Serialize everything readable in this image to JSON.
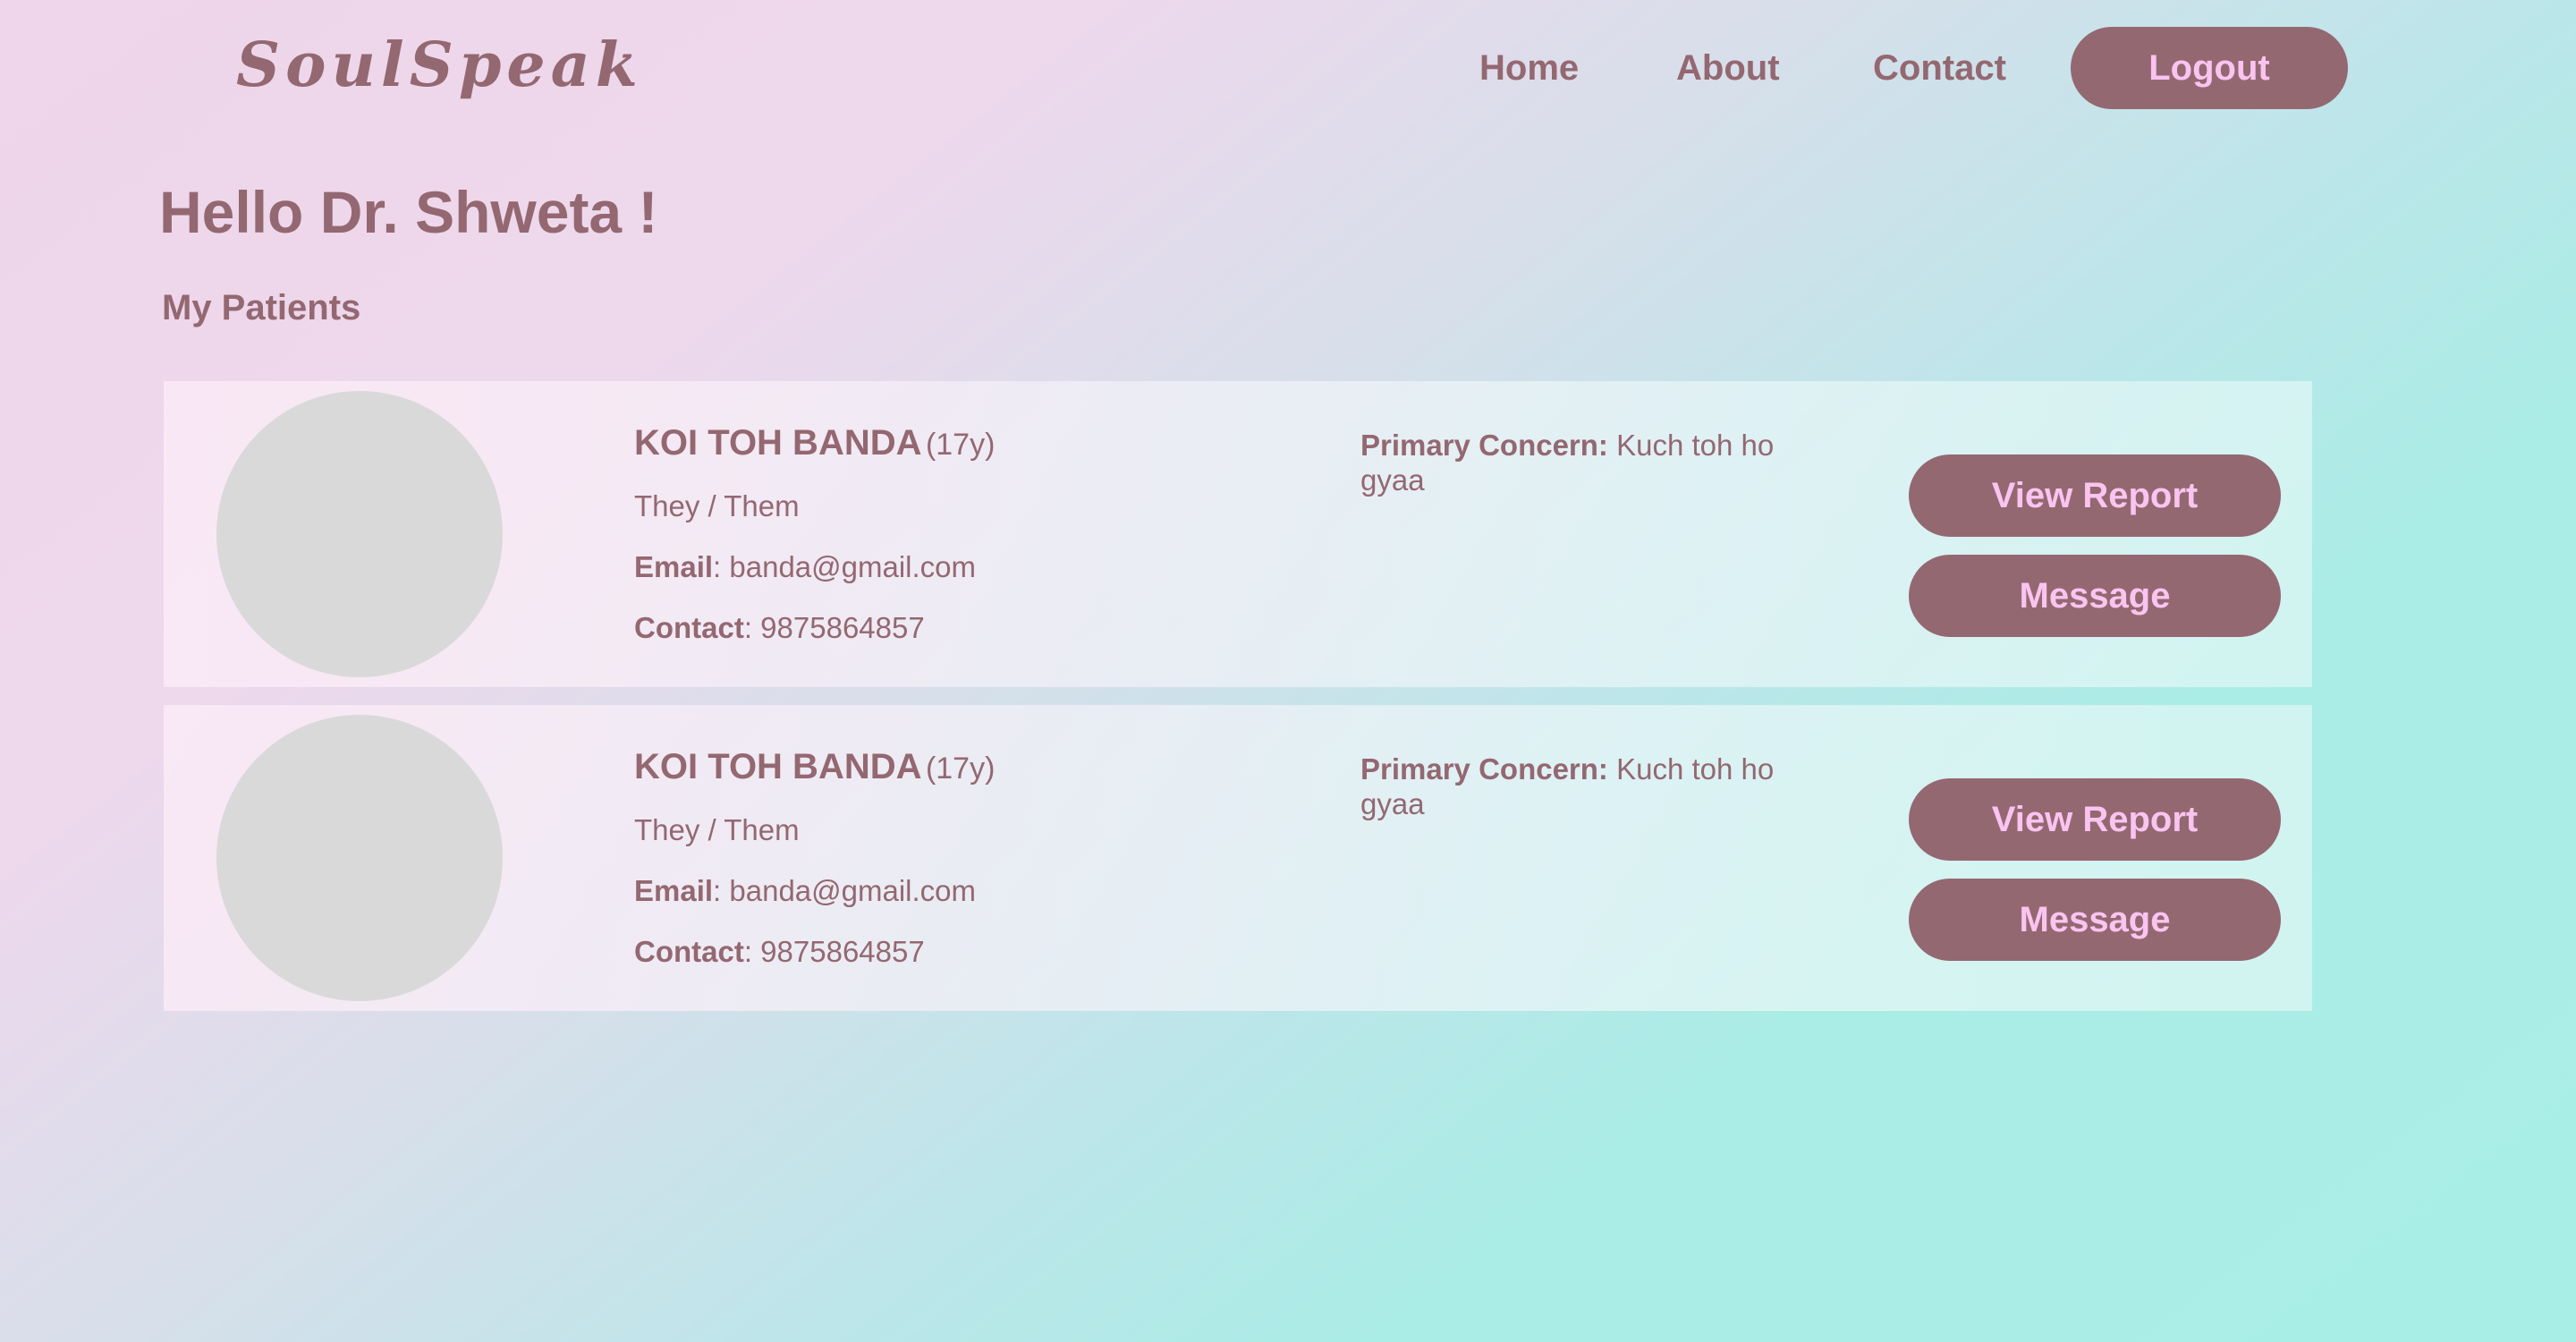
{
  "header": {
    "logo": "SoulSpeak",
    "nav": {
      "home": "Home",
      "about": "About",
      "contact": "Contact"
    },
    "logout_label": "Logout"
  },
  "main": {
    "greeting": "Hello Dr. Shweta !",
    "section_title": "My Patients"
  },
  "patients": [
    {
      "name": "KOI TOH BANDA",
      "age": "(17y)",
      "pronouns": "They / Them",
      "email_label": "Email",
      "email": ": banda@gmail.com",
      "contact_label": "Contact",
      "contact": ": 9875864857",
      "concern_label": "Primary Concern:",
      "concern": " Kuch toh ho gyaa",
      "view_report_label": "View Report",
      "message_label": "Message"
    },
    {
      "name": "KOI TOH BANDA",
      "age": "(17y)",
      "pronouns": "They / Them",
      "email_label": "Email",
      "email": ": banda@gmail.com",
      "contact_label": "Contact",
      "contact": ": 9875864857",
      "concern_label": "Primary Concern:",
      "concern": " Kuch toh ho gyaa",
      "view_report_label": "View Report",
      "message_label": "Message"
    }
  ],
  "colors": {
    "primary": "#946871",
    "button_text": "#f9c4f0",
    "avatar_placeholder": "#d9d9d9",
    "background_start": "#efd6ea",
    "background_end": "#a9eee6"
  }
}
